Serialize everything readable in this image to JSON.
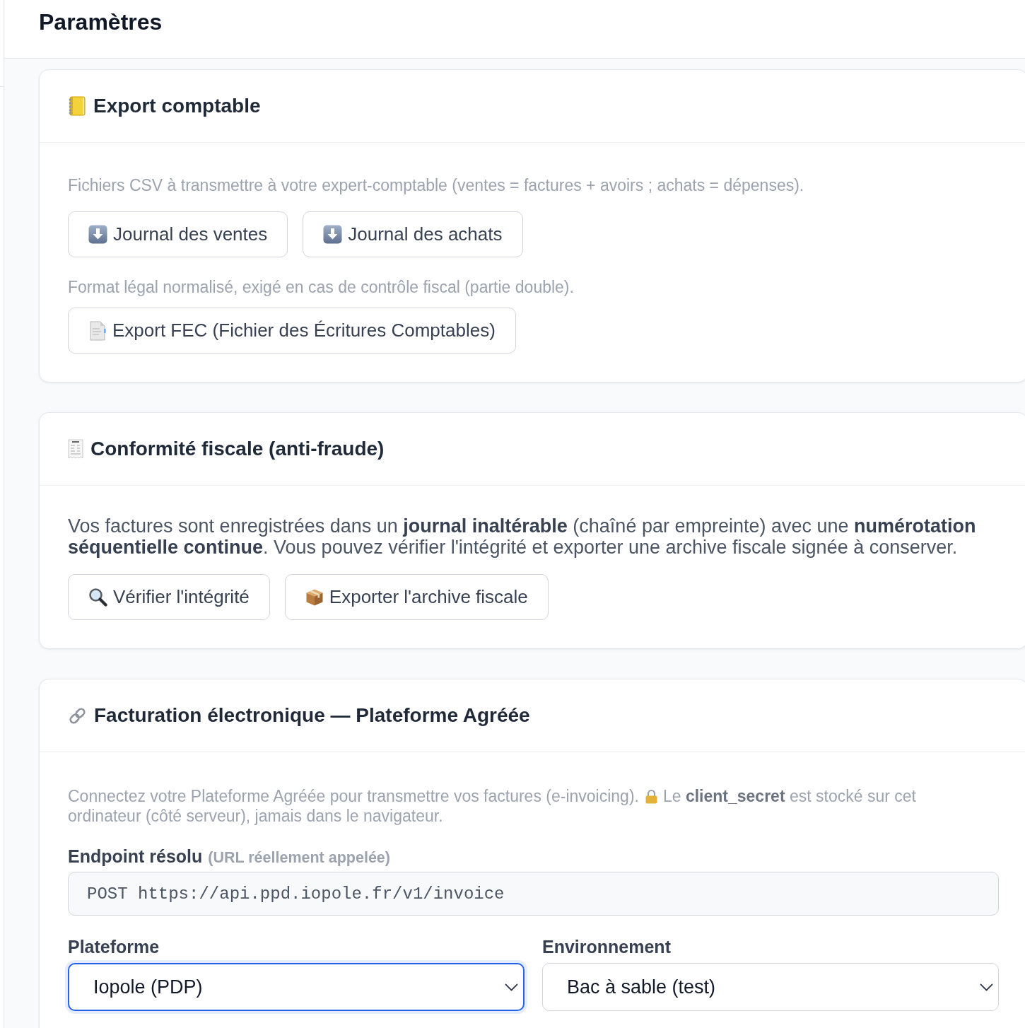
{
  "header": {
    "title": "Paramètres"
  },
  "export_section": {
    "title": "Export comptable",
    "csv_note": "Fichiers CSV à transmettre à votre expert-comptable (ventes = factures + avoirs ; achats = dépenses).",
    "csv_buttons": [
      {
        "label": "Journal des ventes"
      },
      {
        "label": "Journal des achats"
      }
    ],
    "fec_note": "Format légal normalisé, exigé en cas de contrôle fiscal (partie double).",
    "fec_button": {
      "label": "Export FEC (Fichier des Écritures Comptables)"
    }
  },
  "compliance_section": {
    "title": "Conformité fiscale (anti-fraude)",
    "text": "Vos factures sont enregistrées dans un **journal inaltérable** (chaîné par empreinte) avec une **numérotation séquentielle continue**. Vous pouvez vérifier l'intégrité et exporter une archive fiscale signée à conserver.",
    "buttons": [
      {
        "label": "Vérifier l'intégrité"
      },
      {
        "label": "Exporter l'archive fiscale"
      }
    ]
  },
  "einvoicing_section": {
    "title": "Facturation électronique — Plateforme Agréée",
    "intro": "Connectez votre Plateforme Agréée pour transmettre vos factures (e-invoicing).",
    "secret_note_lines": [
      "Le **client_secret** est stocké sur cet",
      "ordinateur (côté serveur), jamais dans le navigateur."
    ],
    "endpoint": {
      "label": "Endpoint résolu",
      "hint": "(URL réellement appelée)",
      "value": "POST https://api.ppd.iopole.fr/v1/invoice"
    },
    "fields": [
      {
        "label": "Plateforme",
        "value": "Iopole (PDP)",
        "focused": true
      },
      {
        "label": "Environnement",
        "value": "Bac à sable (test)",
        "focused": false
      }
    ]
  }
}
